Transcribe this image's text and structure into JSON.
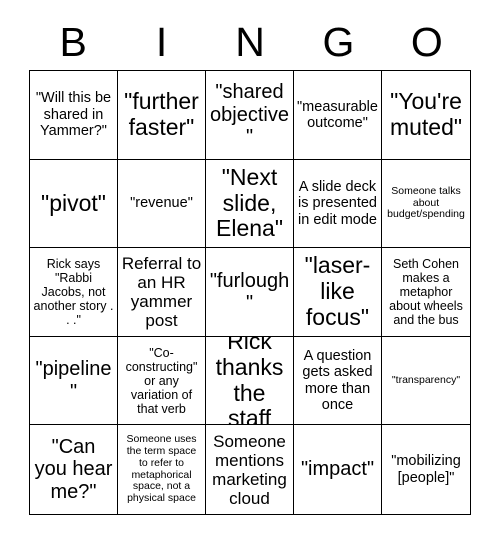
{
  "header": {
    "letters": [
      "B",
      "I",
      "N",
      "G",
      "O"
    ]
  },
  "grid": {
    "rows": [
      {
        "cells": [
          {
            "text": "\"Will this be shared in Yammer?\"",
            "size": "fs-md"
          },
          {
            "text": "\"further faster\"",
            "size": "fs-xxl"
          },
          {
            "text": "\"shared objective\"",
            "size": "fs-xl"
          },
          {
            "text": "\"measurable outcome\"",
            "size": "fs-md"
          },
          {
            "text": "\"You're muted\"",
            "size": "fs-xxl"
          }
        ]
      },
      {
        "cells": [
          {
            "text": "\"pivot\"",
            "size": "fs-xxl"
          },
          {
            "text": "\"revenue\"",
            "size": "fs-md"
          },
          {
            "text": "\"Next slide, Elena\"",
            "size": "fs-xxl"
          },
          {
            "text": "A slide deck is presented in edit mode",
            "size": "fs-md"
          },
          {
            "text": "Someone talks about budget/spending",
            "size": "fs-xs"
          }
        ]
      },
      {
        "cells": [
          {
            "text": "Rick says \"Rabbi Jacobs, not another story . . .\"",
            "size": "fs-sm"
          },
          {
            "text": "Referral to an HR yammer post",
            "size": "fs-lg"
          },
          {
            "text": "\"furlough\"",
            "size": "fs-xl"
          },
          {
            "text": "\"laser-like focus\"",
            "size": "fs-xxl"
          },
          {
            "text": "Seth Cohen makes a metaphor about wheels and the bus",
            "size": "fs-sm"
          }
        ]
      },
      {
        "cells": [
          {
            "text": "\"pipeline\"",
            "size": "fs-xl"
          },
          {
            "text": "\"Co-constructing\" or any variation of that verb",
            "size": "fs-sm"
          },
          {
            "text": "Rick thanks the staff",
            "size": "fs-xxl"
          },
          {
            "text": "A question gets asked more than once",
            "size": "fs-md"
          },
          {
            "text": "\"transparency\"",
            "size": "fs-xs"
          }
        ]
      },
      {
        "cells": [
          {
            "text": "\"Can you hear me?\"",
            "size": "fs-xl"
          },
          {
            "text": "Someone uses the term space to refer to metaphorical space, not a physical space",
            "size": "fs-xs"
          },
          {
            "text": "Someone mentions marketing cloud",
            "size": "fs-lg"
          },
          {
            "text": "\"impact\"",
            "size": "fs-xl"
          },
          {
            "text": "\"mobilizing [people]\"",
            "size": "fs-md"
          }
        ]
      }
    ]
  }
}
